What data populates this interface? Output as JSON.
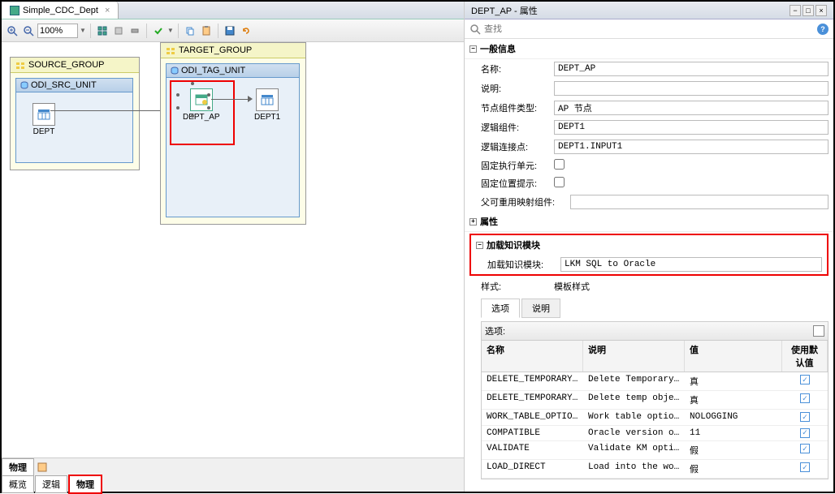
{
  "tab": {
    "title": "Simple_CDC_Dept"
  },
  "toolbar": {
    "zoom": "100%"
  },
  "canvas": {
    "source_group": {
      "title": "SOURCE_GROUP",
      "unit": "ODI_SRC_UNIT",
      "node": "DEPT"
    },
    "target_group": {
      "title": "TARGET_GROUP",
      "unit": "ODI_TAG_UNIT",
      "ap_node": "DEPT_AP",
      "out_node": "DEPT1"
    }
  },
  "bottom_tabs": {
    "row1": [
      "物理"
    ],
    "row2": [
      "概览",
      "逻辑",
      "物理"
    ]
  },
  "properties": {
    "title": "DEPT_AP - 属性",
    "search_placeholder": "查找",
    "sections": {
      "general": "一般信息",
      "attrs": "属性",
      "lkm": "加载知识模块"
    },
    "general_rows": {
      "name_label": "名称:",
      "name_value": "DEPT_AP",
      "desc_label": "说明:",
      "desc_value": "",
      "nodetype_label": "节点组件类型:",
      "nodetype_value": "AP 节点",
      "logiccomp_label": "逻辑组件:",
      "logiccomp_value": "DEPT1",
      "connector_label": "逻辑连接点:",
      "connector_value": "DEPT1.INPUT1",
      "exec_label": "固定执行单元:",
      "pos_label": "固定位置提示:",
      "reuse_label": "父可重用映射组件:",
      "reuse_value": ""
    },
    "lkm_label": "加载知识模块:",
    "lkm_value": "LKM SQL to Oracle",
    "style_label": "样式:",
    "style_value": "模板样式",
    "opt_tabs": [
      "选项",
      "说明"
    ],
    "opt_header": "选项:",
    "opt_cols": {
      "name": "名称",
      "desc": "说明",
      "val": "值",
      "def": "使用默认值"
    },
    "options": [
      {
        "name": "DELETE_TEMPORARY_...",
        "desc": "Delete Temporary ...",
        "val": "真",
        "def": true
      },
      {
        "name": "DELETE_TEMPORARY_...",
        "desc": "Delete temp objec...",
        "val": "真",
        "def": true
      },
      {
        "name": "WORK_TABLE_OPTIONS",
        "desc": "Work table options",
        "val": "NOLOGGING",
        "def": true
      },
      {
        "name": "COMPATIBLE",
        "desc": "Oracle version of...",
        "val": "11",
        "def": true
      },
      {
        "name": "VALIDATE",
        "desc": "Validate KM options",
        "val": "假",
        "def": true
      },
      {
        "name": "LOAD_DIRECT",
        "desc": "Load into the wor...",
        "val": "假",
        "def": true
      }
    ]
  }
}
